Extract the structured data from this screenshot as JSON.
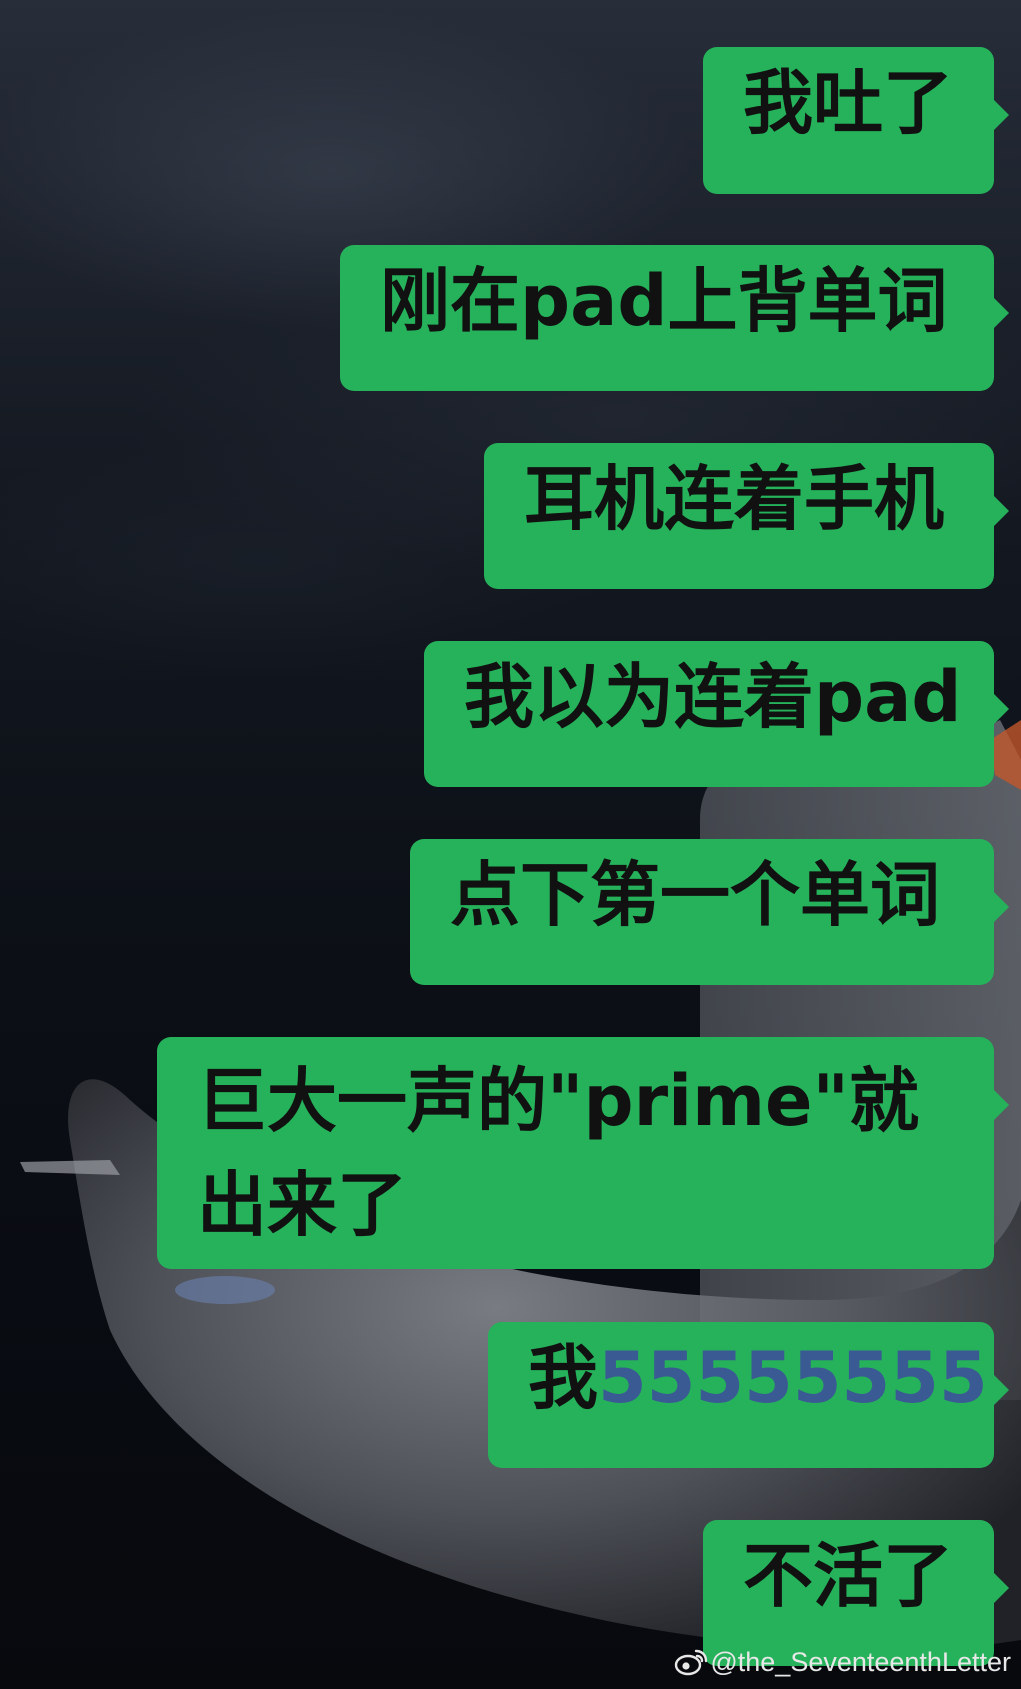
{
  "messages": [
    {
      "text": "我吐了"
    },
    {
      "text": "刚在pad上背单词"
    },
    {
      "text": "耳机连着手机"
    },
    {
      "text": "我以为连着pad"
    },
    {
      "text": "点下第一个单词"
    },
    {
      "text": "巨大一声的\"prime\"就出来了"
    },
    {
      "prefix": "我",
      "number": "55555555"
    },
    {
      "text": "不活了"
    }
  ],
  "watermark": {
    "handle": "@the_SeventeenthLetter",
    "icon": "weibo-logo-icon"
  },
  "colors": {
    "bubble": "#25b25a",
    "number_text": "#3a5a94",
    "background": "#0d1118"
  }
}
